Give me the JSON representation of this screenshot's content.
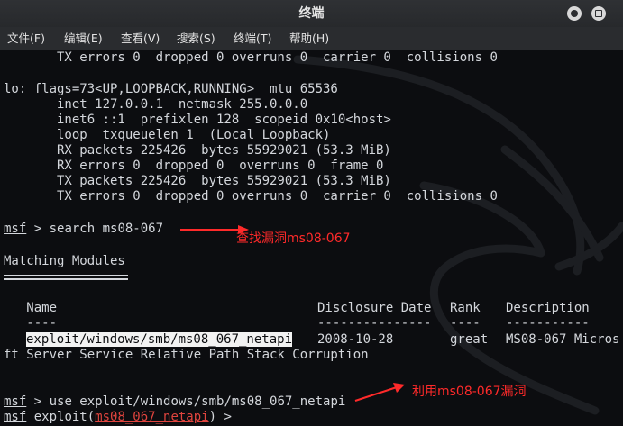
{
  "window": {
    "title": "终端"
  },
  "menu": [
    {
      "label": "文件(F)"
    },
    {
      "label": "编辑(E)"
    },
    {
      "label": "查看(V)"
    },
    {
      "label": "搜索(S)"
    },
    {
      "label": "终端(T)"
    },
    {
      "label": "帮助(H)"
    }
  ],
  "terminal": {
    "iface_top_tx_errors": "       TX errors 0  dropped 0 overruns 0  carrier 0  collisions 0",
    "lo_flags": "lo: flags=73<UP,LOOPBACK,RUNNING>  mtu 65536",
    "lo_inet": "       inet 127.0.0.1  netmask 255.0.0.0",
    "lo_inet6": "       inet6 ::1  prefixlen 128  scopeid 0x10<host>",
    "lo_loop": "       loop  txqueuelen 1  (Local Loopback)",
    "lo_rx_packets": "       RX packets 225426  bytes 55929021 (53.3 MiB)",
    "lo_rx_errors": "       RX errors 0  dropped 0  overruns 0  frame 0",
    "lo_tx_packets": "       TX packets 225426  bytes 55929021 (53.3 MiB)",
    "lo_tx_errors": "       TX errors 0  dropped 0 overruns 0  carrier 0  collisions 0",
    "prompt_msf": "msf",
    "search_cmd": " > search ms08-067",
    "matching_modules": "Matching Modules",
    "col_name": "   Name",
    "col_disclosure": "Disclosure Date",
    "col_rank": "Rank",
    "col_description": "Description",
    "dash_name": "   ----",
    "dash_disclosure": "---------------",
    "dash_rank": "----",
    "dash_description": "-----------",
    "result_name": "exploit/windows/smb/ms08_067_netapi",
    "result_date": "2008-10-28",
    "result_rank": "great",
    "result_desc": "MS08-067 Micros",
    "result_desc_wrap": "ft Server Service Relative Path Stack Corruption",
    "use_cmd": " > use exploit/windows/smb/ms08_067_netapi",
    "exploit_prefix": " exploit(",
    "exploit_module": "ms08_067_netapi",
    "exploit_suffix": ") > "
  },
  "annotations": {
    "search_note": "查找漏洞ms08-067",
    "use_note": "利用ms08-067漏洞",
    "color": "#ff2a2a"
  },
  "icons": {
    "minimize": "minimize-icon",
    "maximize": "maximize-icon",
    "watermark": "kali-dragon-watermark"
  }
}
